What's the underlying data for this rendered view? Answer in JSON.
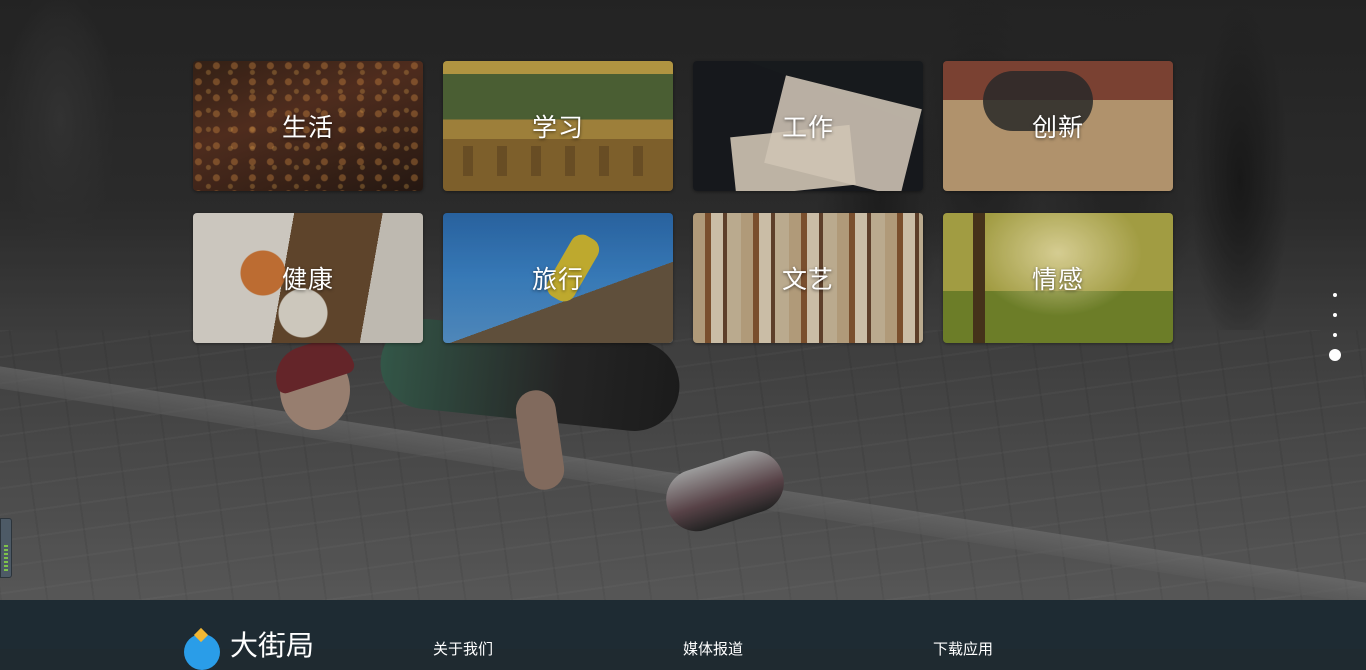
{
  "categories": [
    {
      "label": "生活"
    },
    {
      "label": "学习"
    },
    {
      "label": "工作"
    },
    {
      "label": "创新"
    },
    {
      "label": "健康"
    },
    {
      "label": "旅行"
    },
    {
      "label": "文艺"
    },
    {
      "label": "情感"
    }
  ],
  "pager": {
    "active_index": 3,
    "count": 4
  },
  "footer": {
    "logo_text": "大街局",
    "links": [
      "关于我们",
      "媒体报道",
      "下载应用"
    ]
  },
  "colors": {
    "footer_bg": "#1e2b33",
    "logo_blue": "#2a9de8",
    "logo_yellow": "#f2b733"
  }
}
